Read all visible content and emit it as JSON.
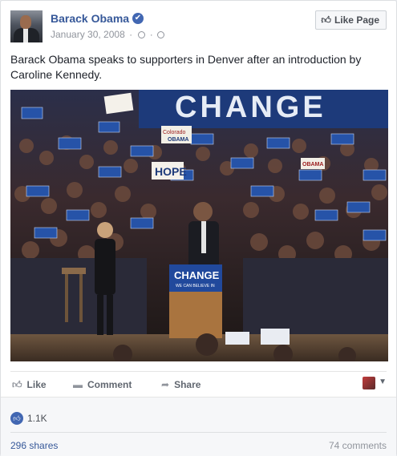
{
  "post": {
    "author": "Barack Obama",
    "verified_mark": "✔",
    "date": "January 30, 2008",
    "caption": "Barack Obama speaks to supporters in Denver after an introduction by Caroline Kennedy.",
    "like_page_label": "Like Page",
    "photo": {
      "backdrop_text": "CHANGE",
      "podium_text": "CHANGE",
      "podium_subtext": "WE CAN BELIEVE IN",
      "hope_sign": "HOPE",
      "sign_colorado": "Colorado",
      "sign_colorado_2": "OBAMA",
      "sign_obama_small": "OBAMA"
    }
  },
  "actions": {
    "like": "Like",
    "comment": "Comment",
    "share": "Share"
  },
  "stats": {
    "likes": "1.1K",
    "shares": "296 shares",
    "comments": "74 comments"
  },
  "icons": {
    "verified": "verified-badge-icon",
    "globe": "globe-icon",
    "clock": "clock-icon",
    "thumb": "thumbs-up-icon",
    "comment": "comment-bubble-icon",
    "share": "share-arrow-icon",
    "caret": "chevron-down-icon"
  },
  "colors": {
    "link": "#365899",
    "brand": "#4267b2",
    "muted": "#90949c"
  }
}
